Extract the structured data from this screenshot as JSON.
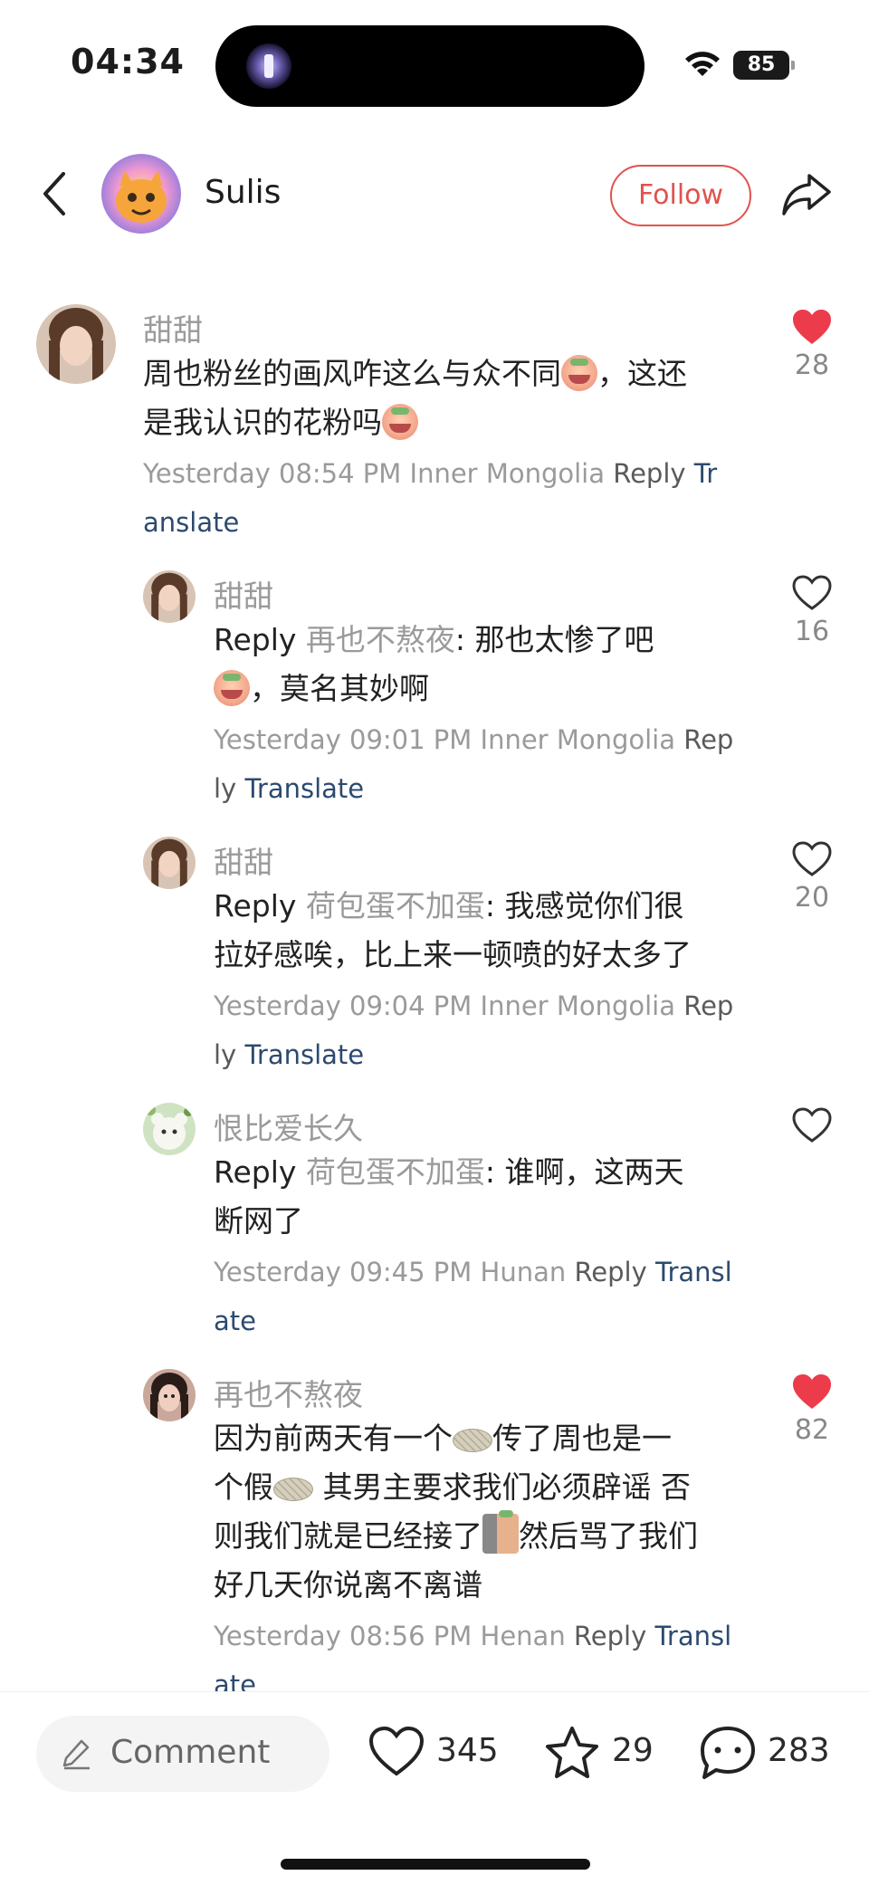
{
  "status": {
    "time": "04:34",
    "battery": "85"
  },
  "header": {
    "username": "Sulis",
    "follow_label": "Follow"
  },
  "comments": [
    {
      "nick": "甜甜",
      "text": "周也粉丝的画风咋这么与众不同",
      "text2": "，这还",
      "text3": "是我认识的花粉吗",
      "meta_time": "Yesterday 08:54 PM Inner Mongolia ",
      "reply": "Reply",
      "translate_a": "Tr",
      "translate_b": "anslate",
      "likes": "28",
      "liked": true
    },
    {
      "nick": "甜甜",
      "reply_prefix": "Reply ",
      "reply_to": "再也不熬夜",
      "text": ": 那也太惨了吧",
      "text2": "，莫名其妙啊",
      "meta_time": "Yesterday 09:01 PM Inner Mongolia ",
      "reply_a": "Rep",
      "reply_b": "ly ",
      "translate": "Translate",
      "likes": "16",
      "liked": false
    },
    {
      "nick": "甜甜",
      "reply_prefix": "Reply ",
      "reply_to": "荷包蛋不加蛋",
      "text": ": 我感觉你们很",
      "text2": "拉好感唉，比上来一顿喷的好太多了",
      "meta_time": "Yesterday 09:04 PM Inner Mongolia ",
      "reply_a": "Rep",
      "reply_b": "ly ",
      "translate": "Translate",
      "likes": "20",
      "liked": false
    },
    {
      "nick": "恨比爱长久",
      "reply_prefix": "Reply ",
      "reply_to": "荷包蛋不加蛋",
      "text": ": 谁啊，这两天",
      "text2": "断网了",
      "meta_time": "Yesterday 09:45 PM Hunan ",
      "reply": "Reply",
      "translate_a": " Transl",
      "translate_b": "ate",
      "likes": "",
      "liked": false
    },
    {
      "nick": "再也不熬夜",
      "text": "因为前两天有一个",
      "text_b": "传了周也是一",
      "text2": "个假",
      "text2_b": " 其男主要求我们必须辟谣 否",
      "text3": "则我们就是已经接了",
      "text3_b": "然后骂了我们",
      "text4": "好几天你说离不离谱",
      "meta_time": "Yesterday 08:56 PM Henan ",
      "reply": "Reply",
      "translate_a": " Transl",
      "translate_b": "ate",
      "likes": "82",
      "liked": true
    }
  ],
  "bottom": {
    "comment_placeholder": "Comment",
    "likes": "345",
    "stars": "29",
    "comments": "283"
  },
  "colors": {
    "accent": "#e0524d",
    "like_red": "#ec3b4b",
    "translate": "#2c4a6e"
  },
  "icons": [
    "back-icon",
    "share-icon",
    "heart-icon",
    "star-icon",
    "chat-bubble-icon",
    "pen-icon",
    "wifi-icon",
    "battery-icon"
  ]
}
